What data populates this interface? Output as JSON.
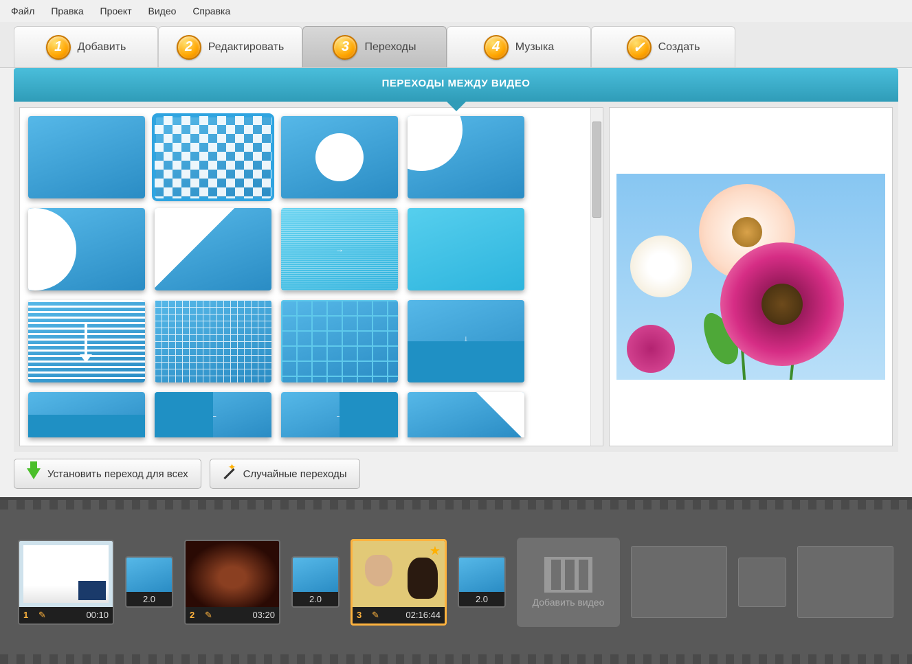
{
  "menu": {
    "file": "Файл",
    "edit": "Правка",
    "project": "Проект",
    "video": "Видео",
    "help": "Справка"
  },
  "steps": [
    {
      "num": "1",
      "label": "Добавить"
    },
    {
      "num": "2",
      "label": "Редактировать"
    },
    {
      "num": "3",
      "label": "Переходы"
    },
    {
      "num": "4",
      "label": "Музыка"
    },
    {
      "num": "✓",
      "label": "Создать"
    }
  ],
  "section_title": "ПЕРЕХОДЫ МЕЖДУ ВИДЕО",
  "selected_transition_index": 1,
  "actions": {
    "set_for_all": "Установить переход для всех",
    "random": "Случайные переходы"
  },
  "timeline": {
    "clips": [
      {
        "index": "1",
        "duration": "00:10"
      },
      {
        "index": "2",
        "duration": "03:20"
      },
      {
        "index": "3",
        "duration": "02:16:44"
      }
    ],
    "transition_duration": "2.0",
    "add_video": "Добавить видео",
    "selected_clip_index": 2
  }
}
